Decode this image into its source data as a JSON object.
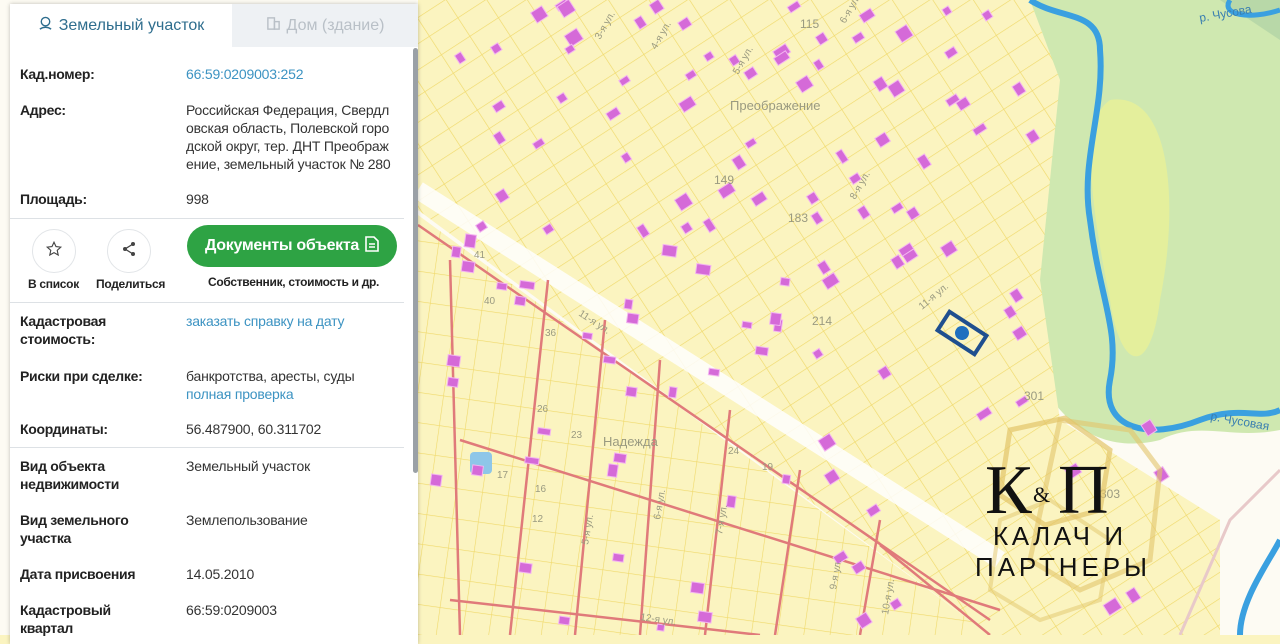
{
  "tabs": [
    {
      "label": "Земельный участок",
      "icon": "map-pin-icon",
      "active": true
    },
    {
      "label": "Дом (здание)",
      "icon": "building-icon",
      "active": false
    }
  ],
  "info": {
    "cad_number": {
      "label": "Кад.номер:",
      "value": "66:59:0209003:252"
    },
    "address": {
      "label": "Адрес:",
      "lines": [
        "Российская Федерация, Свердл",
        "овская область, Полевской горо",
        "дской округ, тер. ДНТ Преображ",
        "ение, земельный участок № 280"
      ]
    },
    "area": {
      "label": "Площадь:",
      "value": "998"
    }
  },
  "actions": {
    "favorite_label": "В список",
    "share_label": "Поделиться",
    "documents_label": "Документы объекта",
    "documents_sub": "Собственник, стоимость и др."
  },
  "details": {
    "cad_cost": {
      "label_lines": [
        "Кадастровая",
        "стоимость:"
      ],
      "link": "заказать справку на дату"
    },
    "risks": {
      "label": "Риски при сделке:",
      "value": "банкротства, аресты, суды",
      "link": "полная проверка"
    },
    "coords": {
      "label": "Координаты:",
      "value": "56.487900, 60.311702"
    }
  },
  "props": [
    {
      "label_lines": [
        "Вид объекта",
        "недвижимости"
      ],
      "value": "Земельный участок"
    },
    {
      "label_lines": [
        "Вид земельного",
        "участка"
      ],
      "value": "Землепользование"
    },
    {
      "label_lines": [
        "Дата присвоения",
        ""
      ],
      "value": "14.05.2010"
    },
    {
      "label_lines": [
        "Кадастровый",
        "квартал"
      ],
      "value": "66:59:0209003"
    }
  ],
  "map": {
    "labels": {
      "settlement1": "Преображение",
      "settlement2": "Надежда",
      "river1": "р. Чусова",
      "river2": "р. Чусовая",
      "st3": "3-я ул.",
      "st4": "4-я ул.",
      "st5": "5-я ул.",
      "st6": "6-я ул.",
      "st8": "8-я ул.",
      "st11": "11-я ул.",
      "st11b": "11-я ул.",
      "st12": "12-я ул.",
      "st5b": "5-я ул.",
      "st6b": "6-я ул.",
      "st7": "7-я ул.",
      "st9": "9-я ул.",
      "st10": "10-я ул.",
      "n115": "115",
      "n149": "149",
      "n183": "183",
      "n214": "214",
      "n301": "301",
      "n303": "303",
      "n41": "41",
      "n40": "40",
      "n36": "36",
      "n26": "26",
      "n23": "23",
      "n17": "17",
      "n16": "16",
      "n12": "12",
      "n19": "19",
      "n24": "24"
    },
    "colors": {
      "parcel_fill": "#fbf4c0",
      "parcel_line": "#f0d96a",
      "building": "#d56ad8",
      "forest": "#cfe8b0",
      "river": "#3aa0e0",
      "street_red": "#e07a7a",
      "selected": "#1f4f8f"
    }
  },
  "logo": {
    "mark": "К&П",
    "line1": "КАЛАЧ И",
    "line2": "ПАРТНЕРЫ"
  }
}
